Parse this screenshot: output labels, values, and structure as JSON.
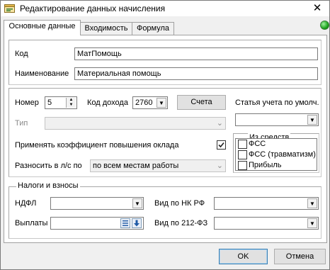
{
  "window": {
    "title": "Редактирование данных начисления",
    "close_glyph": "✕",
    "icon": "app-form-icon",
    "status_color": "#1ea51e"
  },
  "tabs": [
    {
      "label": "Основные данные",
      "active": true
    },
    {
      "label": "Входимость",
      "active": false
    },
    {
      "label": "Формула",
      "active": false
    }
  ],
  "main": {
    "code_label": "Код",
    "code_value": "МатПомощь",
    "name_label": "Наименование",
    "name_value": "Материальная помощь"
  },
  "params": {
    "number_label": "Номер",
    "number_value": "5",
    "income_code_label": "Код дохода",
    "income_code_value": "2760",
    "accounts_button": "Счета",
    "type_label": "Тип",
    "type_value": "",
    "coef_label": "Применять коэффициент повышения оклада",
    "coef_checked": true,
    "distribute_label": "Разносить в л/с по",
    "distribute_value": "по всем местам работы"
  },
  "account_item": {
    "label": "Статья учета по умолч.",
    "value": ""
  },
  "funds": {
    "title": "Из средств",
    "items": [
      {
        "label": "ФСС",
        "checked": false
      },
      {
        "label": "ФСС (травматизм)",
        "checked": false
      },
      {
        "label": "Прибыль",
        "checked": false
      }
    ]
  },
  "taxes": {
    "title": "Налоги и взносы",
    "ndfl_label": "НДФЛ",
    "ndfl_value": "",
    "nk_label": "Вид по НК РФ",
    "nk_value": "",
    "payments_label": "Выплаты",
    "payments_value": "",
    "fz_label": "Вид по 212-ФЗ",
    "fz_value": ""
  },
  "footer": {
    "ok": "OK",
    "cancel": "Отмена"
  }
}
